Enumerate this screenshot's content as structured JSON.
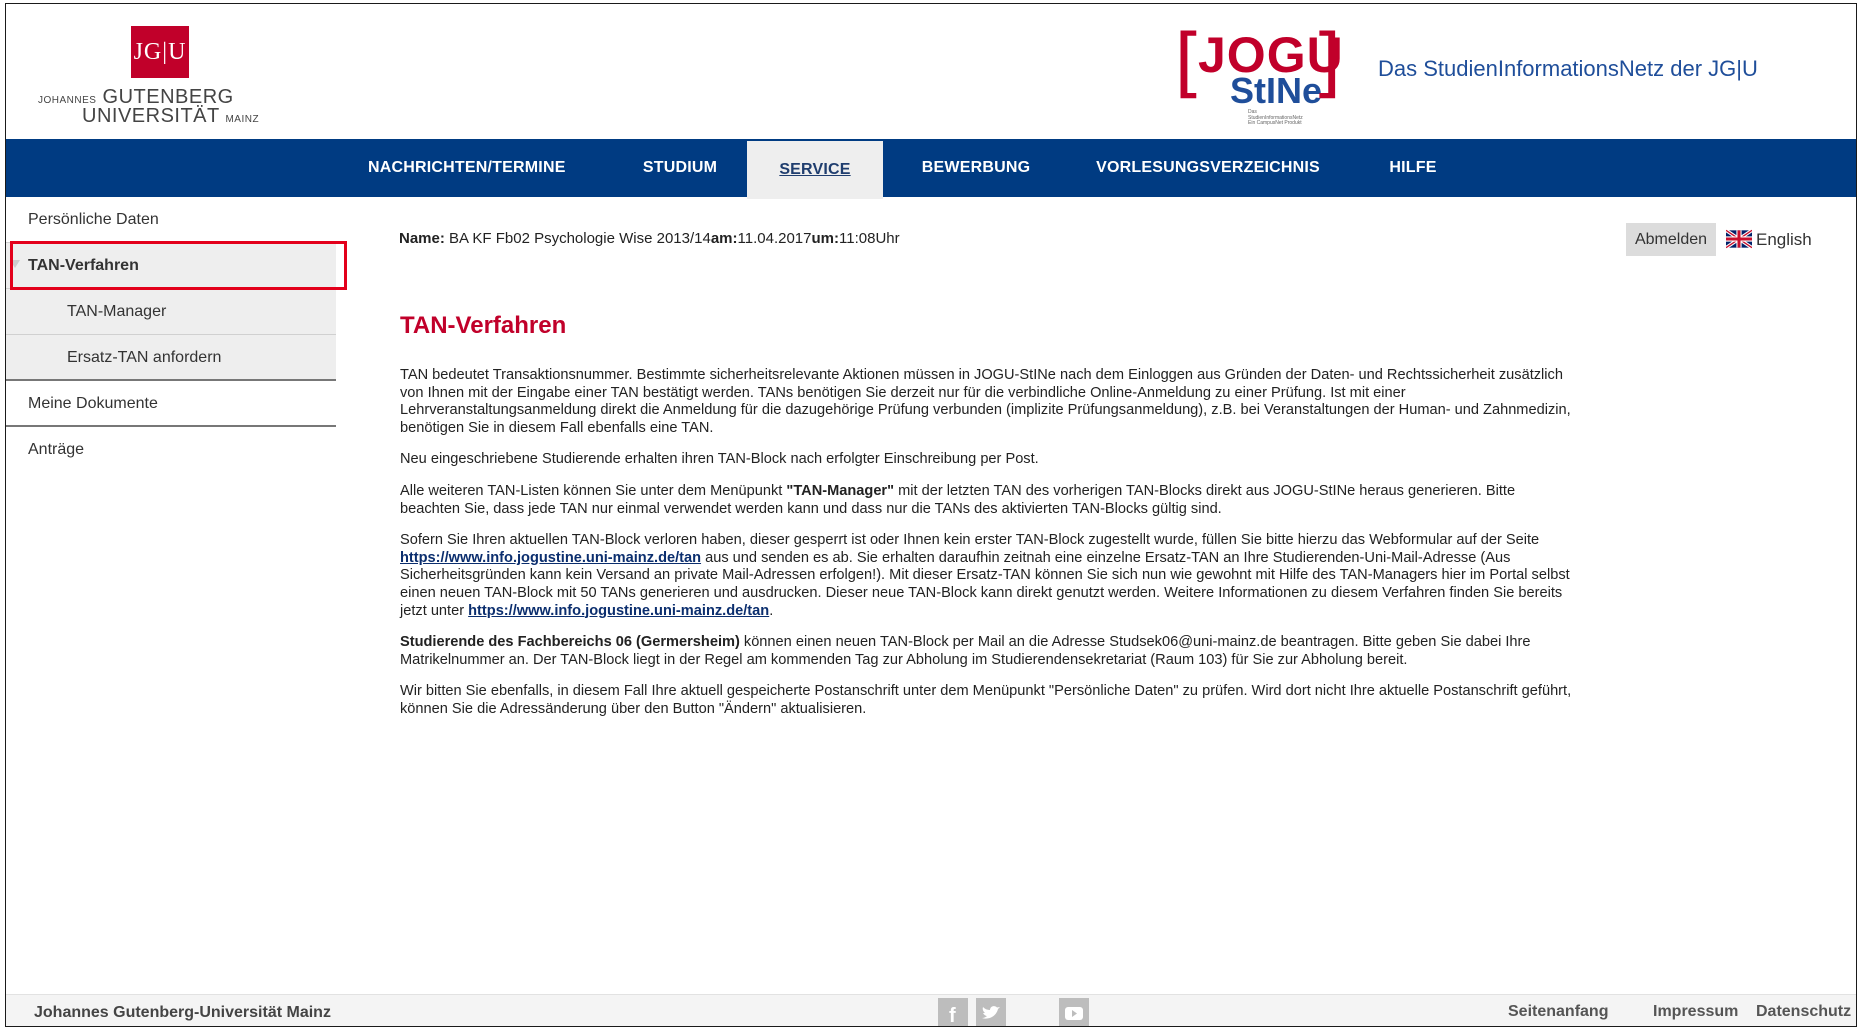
{
  "header": {
    "jgu_logo": {
      "box_text": "JG|U",
      "line1_small": "JOHANNES",
      "line1_big": "GUTENBERG",
      "line2_big": "UNIVERSITÄT",
      "line2_small": "MAINZ"
    },
    "stine_logo": {
      "jogu": "JOGU",
      "stine": "StINe",
      "tagline": "Das StudienInformationsNetz Ein CampusNet Produkt"
    },
    "title": "Das StudienInformationsNetz der JG|U"
  },
  "nav": {
    "items": [
      {
        "label": "NACHRICHTEN/TERMINE"
      },
      {
        "label": "STUDIUM"
      },
      {
        "label": "SERVICE"
      },
      {
        "label": "BEWERBUNG"
      },
      {
        "label": "VORLESUNGSVERZEICHNIS"
      },
      {
        "label": "HILFE"
      }
    ],
    "active": "SERVICE"
  },
  "sidebar": {
    "items": [
      {
        "label": "Persönliche Daten"
      },
      {
        "label": "TAN-Verfahren"
      },
      {
        "label": "TAN-Manager"
      },
      {
        "label": "Ersatz-TAN anfordern"
      },
      {
        "label": "Meine Dokumente"
      },
      {
        "label": "Anträge"
      }
    ]
  },
  "userbar": {
    "name_label": "Name:",
    "name_value": "BA KF Fb02 Psychologie Wise 2013/14",
    "date_label": "am:",
    "date_value": "11.04.2017",
    "time_label": "um:",
    "time_value": "11:08",
    "time_suffix": "Uhr",
    "logout_label": "Abmelden",
    "language_label": "English"
  },
  "main": {
    "title": "TAN-Verfahren",
    "p1": "TAN bedeutet Transaktionsnummer. Bestimmte sicherheitsrelevante Aktionen müssen in JOGU-StINe nach dem Einloggen aus Gründen der Daten- und Rechtssicherheit zusätzlich von Ihnen mit der Eingabe einer TAN bestätigt werden. TANs benötigen Sie derzeit nur für die verbindliche Online-Anmeldung zu einer Prüfung. Ist mit einer Lehrveranstaltungsanmeldung direkt die Anmeldung für die dazugehörige Prüfung verbunden (implizite Prüfungsanmeldung), z.B. bei Veranstaltungen der Human- und Zahnmedizin, benötigen Sie in diesem Fall ebenfalls eine TAN.",
    "p2": "Neu eingeschriebene Studierende erhalten ihren TAN-Block nach erfolgter Einschreibung per Post.",
    "p3_a": "Alle weiteren TAN-Listen können Sie unter dem Menüpunkt ",
    "p3_b": "\"TAN-Manager\"",
    "p3_c": " mit der letzten TAN des vorherigen TAN-Blocks direkt aus JOGU-StINe heraus generieren. Bitte beachten Sie, dass jede TAN nur einmal verwendet werden kann und dass nur die TANs des aktivierten TAN-Blocks gültig sind.",
    "p4_a": "Sofern Sie Ihren aktuellen TAN-Block verloren haben, dieser gesperrt ist oder Ihnen kein erster TAN-Block zugestellt wurde, füllen Sie bitte hierzu das Webformular auf der Seite ",
    "p4_link1": "https://www.info.jogustine.uni-mainz.de/tan",
    "p4_b": " aus und senden es ab. Sie erhalten daraufhin zeitnah eine einzelne Ersatz-TAN an Ihre Studierenden-Uni-Mail-Adresse (Aus Sicherheitsgründen kann kein Versand an private Mail-Adressen erfolgen!). Mit dieser Ersatz-TAN können Sie sich nun wie gewohnt mit Hilfe des TAN-Managers hier im Portal selbst einen neuen TAN-Block mit 50 TANs generieren und ausdrucken. Dieser neue TAN-Block kann direkt genutzt werden. Weitere Informationen zu diesem Verfahren finden Sie bereits jetzt unter ",
    "p4_link2": "https://www.info.jogustine.uni-mainz.de/tan",
    "p4_c": ".",
    "p5_a": "Studierende des Fachbereichs 06 (Germersheim)",
    "p5_b": " können einen neuen TAN-Block per Mail an die Adresse Studsek06@uni-mainz.de beantragen. Bitte geben Sie dabei Ihre Matrikelnummer an. Der TAN-Block liegt in der Regel am kommenden Tag zur Abholung im Studierendensekretariat (Raum 103) für Sie zur Abholung bereit.",
    "p6": "Wir bitten Sie ebenfalls, in diesem Fall Ihre aktuell gespeicherte Postanschrift unter dem Menüpunkt \"Persönliche Daten\" zu prüfen. Wird dort nicht Ihre aktuelle Postanschrift geführt, können Sie die Adressänderung über den Button \"Ändern\" aktualisieren."
  },
  "footer": {
    "left": "Johannes Gutenberg-Universität Mainz",
    "social": [
      "facebook-icon",
      "twitter-icon",
      "youtube-icon"
    ],
    "links": [
      {
        "label": "Seitenanfang"
      },
      {
        "label": "Impressum"
      },
      {
        "label": "Datenschutz"
      }
    ]
  },
  "colors": {
    "brand_red": "#c1002a",
    "nav_blue": "#003b82",
    "title_blue": "#1f4e9a",
    "highlight_red": "#e3001b"
  }
}
